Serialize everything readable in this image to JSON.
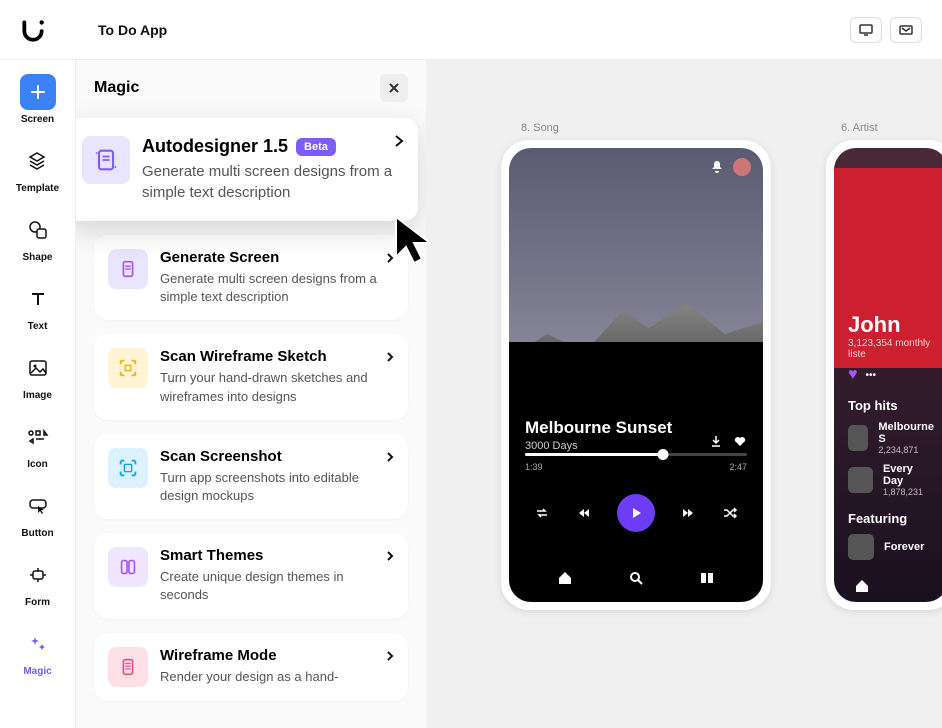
{
  "app_title": "To Do App",
  "magic_panel": {
    "title": "Magic",
    "cards": [
      {
        "title": "Autodesigner 1.5",
        "beta": "Beta",
        "desc": "Generate multi screen designs from a simple text description",
        "icon_bg": "#e9e4ff",
        "icon_color": "#7c5cff"
      },
      {
        "title": "Generate Screen",
        "desc": "Generate multi screen designs from a simple text description",
        "icon_bg": "#e9e4ff",
        "icon_color": "#a855f7"
      },
      {
        "title": "Scan Wireframe Sketch",
        "desc": "Turn your hand-drawn sketches and wireframes into designs",
        "icon_bg": "#fff4d6",
        "icon_color": "#eab308"
      },
      {
        "title": "Scan Screenshot",
        "desc": "Turn app screenshots into editable design mockups",
        "icon_bg": "#dcf2ff",
        "icon_color": "#0ea5e9"
      },
      {
        "title": "Smart Themes",
        "desc": "Create unique design themes in seconds",
        "icon_bg": "#f0e6ff",
        "icon_color": "#a855f7"
      },
      {
        "title": "Wireframe Mode",
        "desc": "Render your design as a hand-",
        "icon_bg": "#ffe0e6",
        "icon_color": "#ec4899"
      }
    ]
  },
  "tools": [
    {
      "label": "Screen",
      "icon": "plus",
      "active": true
    },
    {
      "label": "Template",
      "icon": "layers"
    },
    {
      "label": "Shape",
      "icon": "shape"
    },
    {
      "label": "Text",
      "icon": "text"
    },
    {
      "label": "Image",
      "icon": "image"
    },
    {
      "label": "Icon",
      "icon": "icon"
    },
    {
      "label": "Button",
      "icon": "button"
    },
    {
      "label": "Form",
      "icon": "form"
    },
    {
      "label": "Magic",
      "icon": "magic",
      "magic": true
    }
  ],
  "canvas": {
    "mockups": [
      {
        "label": "8. Song"
      },
      {
        "label": "6. Artist"
      }
    ],
    "song": {
      "title": "Melbourne Sunset",
      "artist": "3000 Days",
      "time_current": "1:39",
      "time_total": "2:47"
    },
    "artist": {
      "name": "John",
      "listeners": "3,123,354 monthly liste",
      "top_hits_label": "Top hits",
      "hits": [
        {
          "title": "Melbourne S",
          "plays": "2,234,871"
        },
        {
          "title": "Every Day",
          "plays": "1,878,231"
        }
      ],
      "featuring_label": "Featuring",
      "featuring": [
        {
          "title": "Forever"
        }
      ]
    }
  }
}
